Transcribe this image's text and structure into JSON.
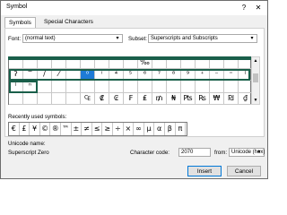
{
  "window": {
    "title": "Symbol",
    "help": "?",
    "close": "✕"
  },
  "tabs": [
    {
      "label": "Symbols",
      "active": true
    },
    {
      "label": "Special Characters",
      "active": false
    }
  ],
  "font": {
    "label": "Font:",
    "value": "(normal text)"
  },
  "subset": {
    "label": "Subset:",
    "value": "Superscripts and Subscripts"
  },
  "grid": {
    "rows": [
      [
        "",
        "",
        "",
        "",
        "",
        "",
        "",
        "",
        "",
        "%o",
        "",
        "",
        "",
        "",
        "",
        "",
        ""
      ],
      [
        "ʔ",
        "‾",
        "/",
        "⁄",
        "",
        "o",
        "i",
        "4",
        "5",
        "6",
        "7",
        "8",
        "9",
        "+",
        "-",
        "=",
        "("
      ],
      [
        ")",
        "n",
        "",
        "",
        "",
        "",
        "",
        "",
        "",
        "",
        "",
        "",
        "",
        "",
        "",
        "",
        ""
      ],
      [
        "",
        "",
        "",
        "",
        "",
        "",
        "",
        "",
        "",
        "",
        "",
        "",
        "",
        "",
        "",
        "",
        ""
      ]
    ],
    "selected": "o"
  },
  "grid_rows_text": {
    "r0": [
      "",
      "",
      "",
      "",
      "",
      "",
      "",
      "",
      "",
      "‰",
      "",
      "",
      "",
      "",
      "",
      "",
      ""
    ],
    "r1": [
      "ʔ",
      "‾",
      "/",
      "⁄",
      "",
      "⁰",
      "ⁱ",
      "⁴",
      "⁵",
      "⁶",
      "⁷",
      "⁸",
      "⁹",
      "⁺",
      "⁻",
      "⁼",
      "⁽"
    ],
    "r2": [
      "⁾",
      "ⁿ",
      "",
      "",
      "",
      "",
      "",
      "",
      "",
      "",
      "",
      "",
      "",
      "",
      "",
      "",
      ""
    ],
    "r3_a": [
      "",
      "",
      "",
      "",
      "",
      "₀",
      "₁",
      "₂",
      "₃",
      "₄",
      "₅",
      "₆",
      "₇",
      "₈",
      "₉",
      "₊",
      "₋"
    ],
    "r3": [
      "",
      "",
      "",
      "",
      "",
      "₠",
      "₡",
      "₢",
      "₣",
      "₤",
      "₥",
      "₦",
      "₧",
      "₨",
      "₩",
      "₪",
      "₫"
    ]
  },
  "recent": {
    "label": "Recently used symbols:",
    "symbols": [
      "€",
      "£",
      "¥",
      "©",
      "®",
      "™",
      "±",
      "≠",
      "≤",
      "≥",
      "÷",
      "×",
      "∞",
      "µ",
      "α",
      "β",
      "π"
    ]
  },
  "info": {
    "unicode_name_label": "Unicode name:",
    "unicode_name_value": "Superscript Zero",
    "character_code_label": "Character code:",
    "character_code_value": "2070",
    "from_label": "from:",
    "from_value": "Unicode (hex)"
  },
  "buttons": {
    "insert": "Insert",
    "cancel": "Cancel"
  },
  "colors": {
    "selection": "#1e7bd6",
    "focus_frame": "#1a5f4a"
  }
}
